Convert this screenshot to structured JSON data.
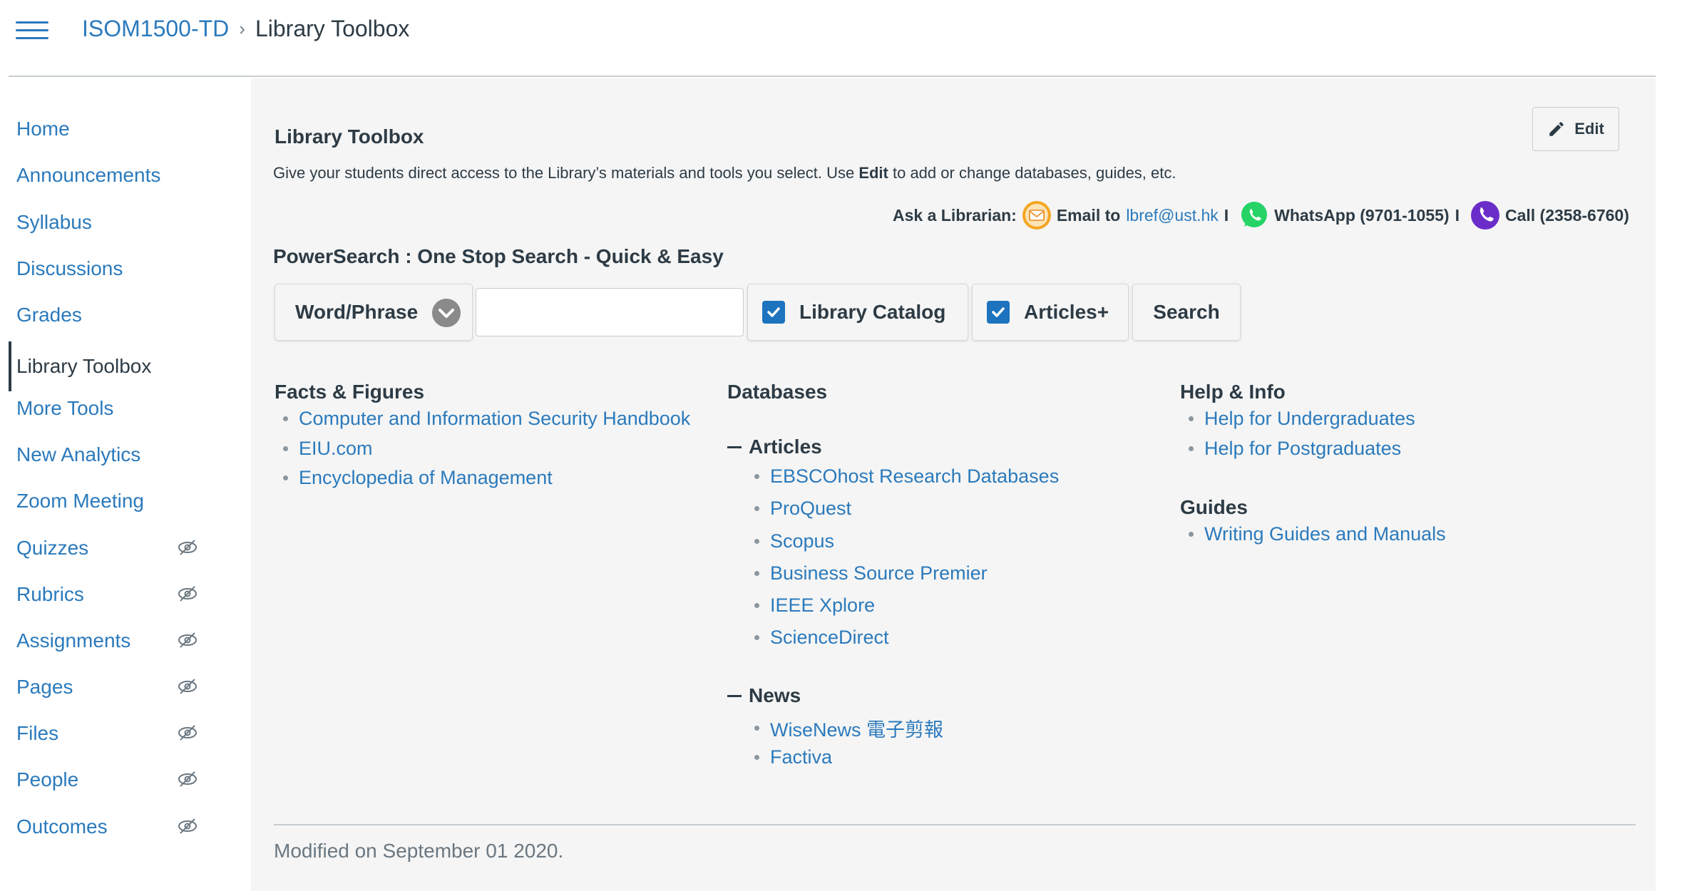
{
  "header": {
    "breadcrumb": {
      "course": "ISOM1500-TD",
      "separator": "›",
      "current": "Library Toolbox"
    }
  },
  "sidebar": {
    "items": [
      {
        "label": "Home",
        "active": false,
        "hidden": false
      },
      {
        "label": "Announcements",
        "active": false,
        "hidden": false
      },
      {
        "label": "Syllabus",
        "active": false,
        "hidden": false
      },
      {
        "label": "Discussions",
        "active": false,
        "hidden": false
      },
      {
        "label": "Grades",
        "active": false,
        "hidden": false
      },
      {
        "label": "Library Toolbox",
        "active": true,
        "hidden": false
      },
      {
        "label": "More Tools",
        "active": false,
        "hidden": false
      },
      {
        "label": "New Analytics",
        "active": false,
        "hidden": false
      },
      {
        "label": "Zoom Meeting",
        "active": false,
        "hidden": false
      },
      {
        "label": "Quizzes",
        "active": false,
        "hidden": true
      },
      {
        "label": "Rubrics",
        "active": false,
        "hidden": true
      },
      {
        "label": "Assignments",
        "active": false,
        "hidden": true
      },
      {
        "label": "Pages",
        "active": false,
        "hidden": true
      },
      {
        "label": "Files",
        "active": false,
        "hidden": true
      },
      {
        "label": "People",
        "active": false,
        "hidden": true
      },
      {
        "label": "Outcomes",
        "active": false,
        "hidden": true
      }
    ]
  },
  "main": {
    "edit_label": "Edit",
    "title": "Library Toolbox",
    "intro_before": "Give your students direct access to the Library’s materials and tools you select. Use ",
    "intro_bold": "Edit",
    "intro_after": " to add or change databases, guides, etc.",
    "ask": {
      "label": "Ask a Librarian:",
      "email_prefix": "Email to",
      "email": "lbref@ust.hk",
      "separator": "I",
      "whatsapp": "WhatsApp (9701-1055)",
      "call": "Call (2358-6760)"
    },
    "powersearch": {
      "title": "PowerSearch : One Stop Search - Quick & Easy",
      "select_value": "Word/Phrase",
      "input_value": "",
      "library_catalog_label": "Library Catalog",
      "library_catalog_checked": true,
      "articles_label": "Articles+",
      "articles_checked": true,
      "search_label": "Search"
    },
    "facts": {
      "heading": "Facts & Figures",
      "links": [
        "Computer and Information Security Handbook",
        "EIU.com",
        "Encyclopedia of Management"
      ]
    },
    "databases": {
      "heading": "Databases",
      "articles_heading": "Articles",
      "articles": [
        "EBSCOhost Research Databases",
        "ProQuest",
        "Scopus",
        "Business Source Premier",
        "IEEE Xplore",
        "ScienceDirect"
      ],
      "news_heading": "News",
      "news": [
        "WiseNews 電子剪報",
        "Factiva"
      ]
    },
    "help": {
      "heading": "Help & Info",
      "links": [
        "Help for Undergraduates",
        "Help for Postgraduates"
      ],
      "guides_heading": "Guides",
      "guides": [
        "Writing Guides and Manuals"
      ]
    },
    "modified": "Modified on September 01 2020."
  },
  "colors": {
    "link": "#2b7abc",
    "text": "#2d3b45",
    "checkbox": "#1e73be",
    "content_bg": "#f5f5f5",
    "email_icon": "#f5a623",
    "whatsapp_icon": "#25d366",
    "call_icon": "#6a2dc9"
  }
}
